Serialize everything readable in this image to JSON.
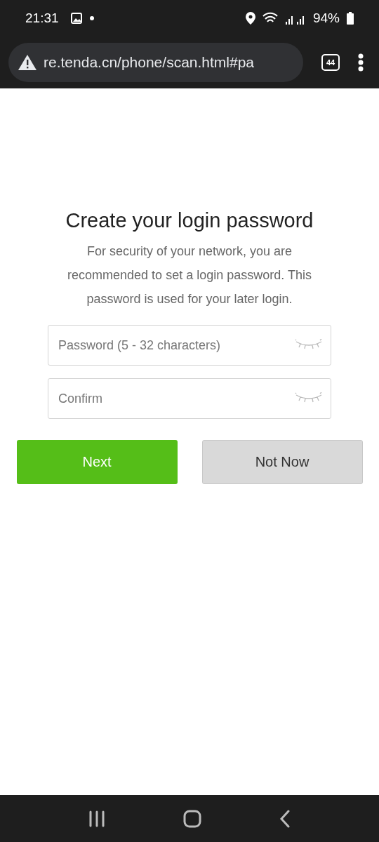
{
  "status_bar": {
    "time": "21:31",
    "battery": "94%"
  },
  "browser": {
    "url": "re.tenda.cn/phone/scan.html#pa",
    "tab_count": "44"
  },
  "form": {
    "title": "Create your login password",
    "description": "For security of your network, you are recommended to set a login password. This password is used for your later login.",
    "fields": [
      {
        "placeholder": "Password (5 - 32 characters)"
      },
      {
        "placeholder": "Confirm"
      }
    ],
    "buttons": [
      {
        "label": "Next",
        "kind": "primary"
      },
      {
        "label": "Not Now",
        "kind": "secondary"
      }
    ]
  }
}
